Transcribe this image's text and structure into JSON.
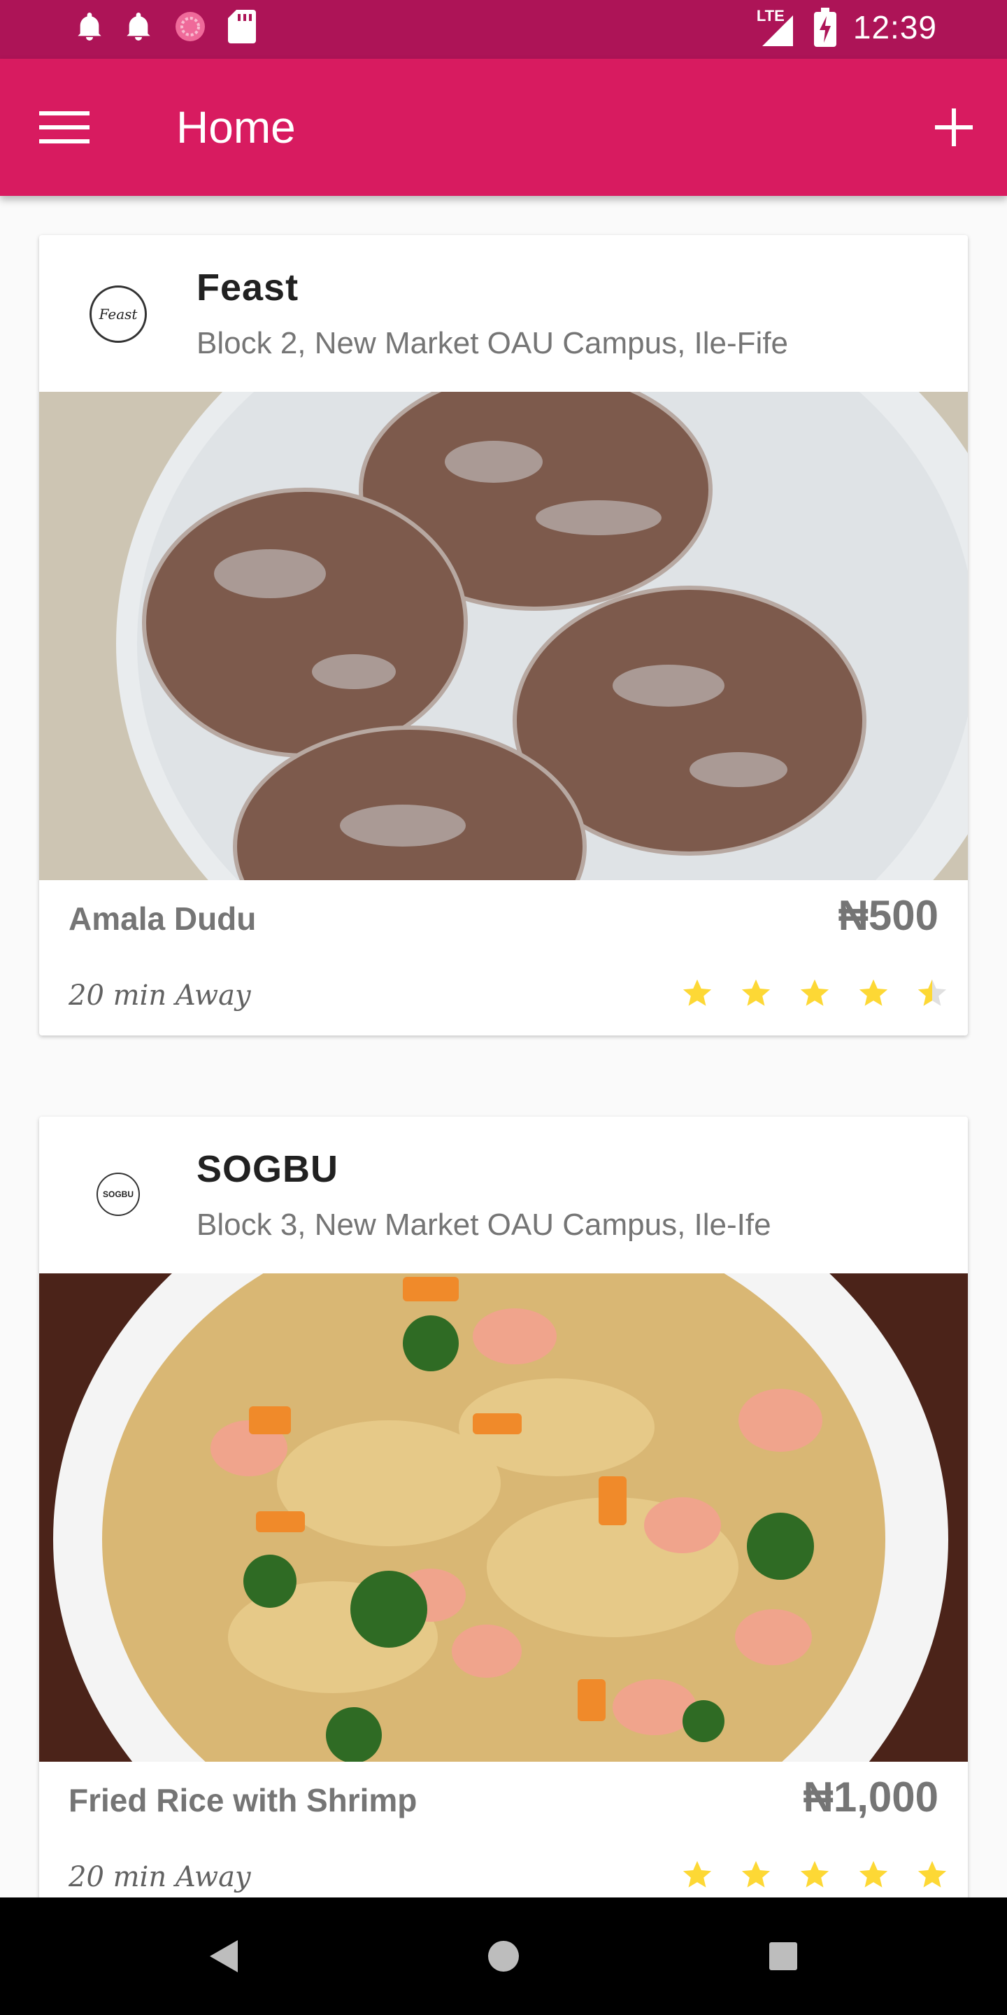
{
  "status_bar": {
    "time": "12:39",
    "network": "LTE",
    "icons": [
      "bell-icon",
      "bell-icon",
      "sync-circle-icon",
      "sd-card-icon",
      "signal-icon",
      "battery-charging-icon"
    ]
  },
  "app_bar": {
    "title": "Home",
    "color": "#d81b60",
    "menu_icon": "hamburger-menu-icon",
    "add_icon": "plus-icon"
  },
  "feed": {
    "items": [
      {
        "shop_name": "Feast",
        "logo_text": "Feast",
        "address": "Block 2, New Market OAU Campus, Ile-Fife",
        "dish": "Amala Dudu",
        "price": "₦500",
        "eta": "20 min Away",
        "rating": 4.5
      },
      {
        "shop_name": "SOGBU",
        "logo_text": "SOGBU",
        "address": "Block 3, New Market OAU Campus, Ile-Ife",
        "dish": "Fried Rice with Shrimp",
        "price": "₦1,000",
        "eta": "20 min Away",
        "rating": 5
      }
    ]
  },
  "nav_bar": {
    "icons": [
      "back-triangle-icon",
      "home-circle-icon",
      "recents-square-icon"
    ]
  },
  "colors": {
    "status_bar": "#ad1457",
    "star": "#fdd835"
  }
}
